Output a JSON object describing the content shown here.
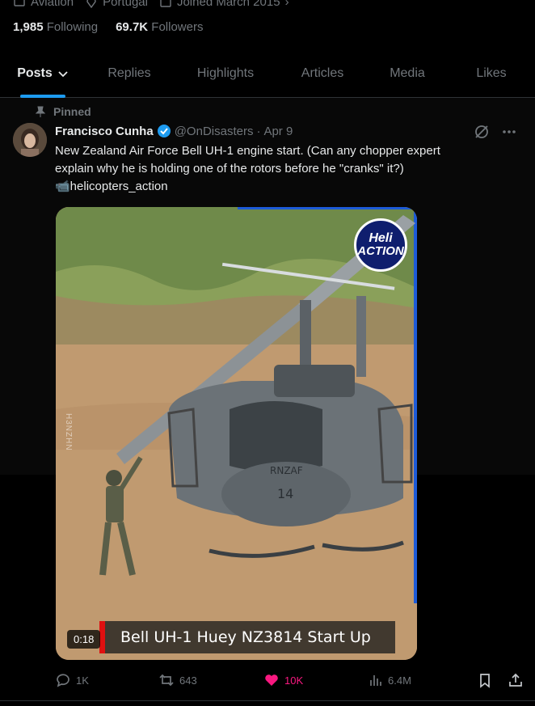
{
  "profile_meta": {
    "category": "Aviation",
    "location": "Portugal",
    "joined": "Joined March 2015"
  },
  "follow": {
    "following_count": "1,985",
    "following_label": "Following",
    "followers_count": "69.7K",
    "followers_label": "Followers"
  },
  "tabs": [
    "Posts",
    "Replies",
    "Highlights",
    "Articles",
    "Media",
    "Likes"
  ],
  "tweet": {
    "pinned_label": "Pinned",
    "name": "Francisco Cunha",
    "handle": "@OnDisasters",
    "dot": "·",
    "date": "Apr 9",
    "text_line1": "New Zealand Air Force Bell UH-1 engine start. (Can any chopper expert",
    "text_line2": "explain why he is holding one of the rotors before he \"cranks\" it?)",
    "text_line3": "📹helicopters_action",
    "media": {
      "duration": "0:18",
      "caption": "Bell UH-1 Huey NZ3814 Start Up",
      "logo_line1": "Heli",
      "logo_line2": "ACTION",
      "watermark": "H3NZHN",
      "tail_text": "RNZAF",
      "nose_number": "14"
    },
    "stats": {
      "replies": "1K",
      "reposts": "643",
      "likes": "10K",
      "views": "6.4M"
    }
  },
  "colors": {
    "accent": "#1d9bf0",
    "like": "#f91880",
    "muted": "#71767b",
    "background": "#000000"
  }
}
